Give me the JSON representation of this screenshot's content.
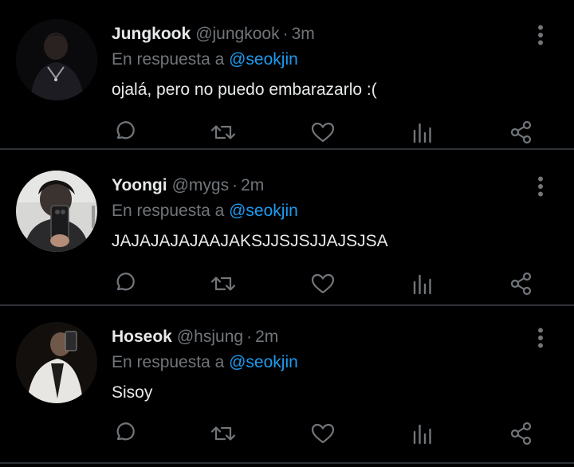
{
  "tweets": [
    {
      "display_name": "Jungkook",
      "handle": "@jungkook",
      "separator": "·",
      "time": "3m",
      "reply_prefix": "En respuesta a",
      "reply_to": "@seokjin",
      "text": "ojalá, pero no puedo embarazarlo :("
    },
    {
      "display_name": "Yoongi",
      "handle": "@mygs",
      "separator": "·",
      "time": "2m",
      "reply_prefix": "En respuesta a",
      "reply_to": "@seokjin",
      "text": "JAJAJAJAJAAJAKSJJSJSJJAJSJSA"
    },
    {
      "display_name": "Hoseok",
      "handle": "@hsjung",
      "separator": "·",
      "time": "2m",
      "reply_prefix": "En respuesta a",
      "reply_to": "@seokjin",
      "text": "Sisoy"
    }
  ],
  "colors": {
    "background": "#000000",
    "primary_text": "#e7e9ea",
    "secondary_text": "#71767b",
    "mention": "#1d9bf0",
    "divider": "#2f3336"
  },
  "icons": [
    "reply-icon",
    "retweet-icon",
    "like-icon",
    "views-icon",
    "share-icon",
    "more-options-icon"
  ]
}
